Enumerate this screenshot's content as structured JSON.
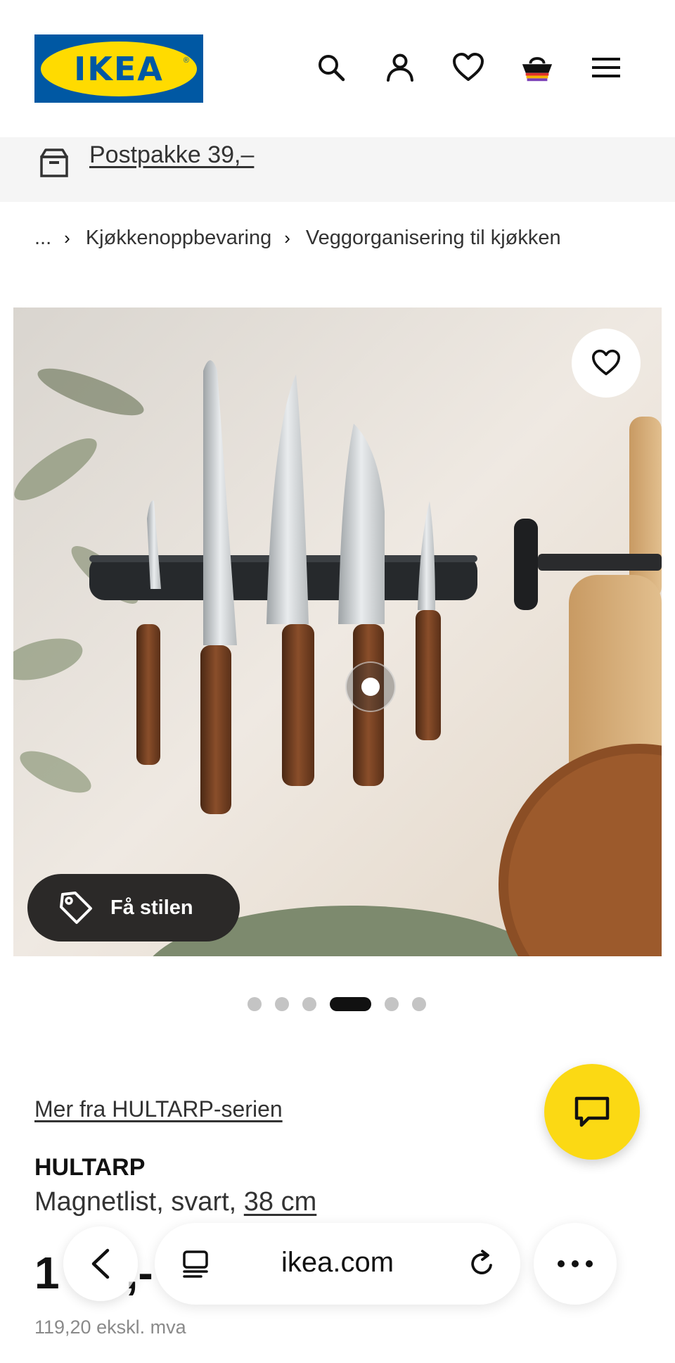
{
  "brand": {
    "logo_text": "IKEA",
    "logo_mark": "®",
    "blue": "#0058a3",
    "yellow": "#ffdb00"
  },
  "header": {
    "icons": [
      "search-icon",
      "account-icon",
      "heart-icon",
      "basket-icon",
      "menu-icon"
    ]
  },
  "delivery": {
    "text": "Postpakke 39,–",
    "icon": "delivery-box-icon"
  },
  "breadcrumb": {
    "ellipsis": "...",
    "separator": "›",
    "items": [
      "Kjøkkenoppbevaring",
      "Veggorganisering til kjøkken"
    ]
  },
  "gallery": {
    "style_button_label": "Få stilen",
    "slide_count": 6,
    "active_slide": 4
  },
  "product": {
    "series_link": "Mer fra HULTARP-serien",
    "name": "HULTARP",
    "description": "Magnetlist, svart,",
    "size_link": "38 cm",
    "price_partial": "1",
    "price_suffix": ",-",
    "price_ex_vat": "119,20 ekskl. mva"
  },
  "browser": {
    "url": "ikea.com",
    "icons": [
      "back-icon",
      "tabs-icon",
      "reload-icon",
      "more-icon"
    ]
  },
  "chat": {
    "icon": "chat-icon",
    "color": "#fbd914"
  }
}
